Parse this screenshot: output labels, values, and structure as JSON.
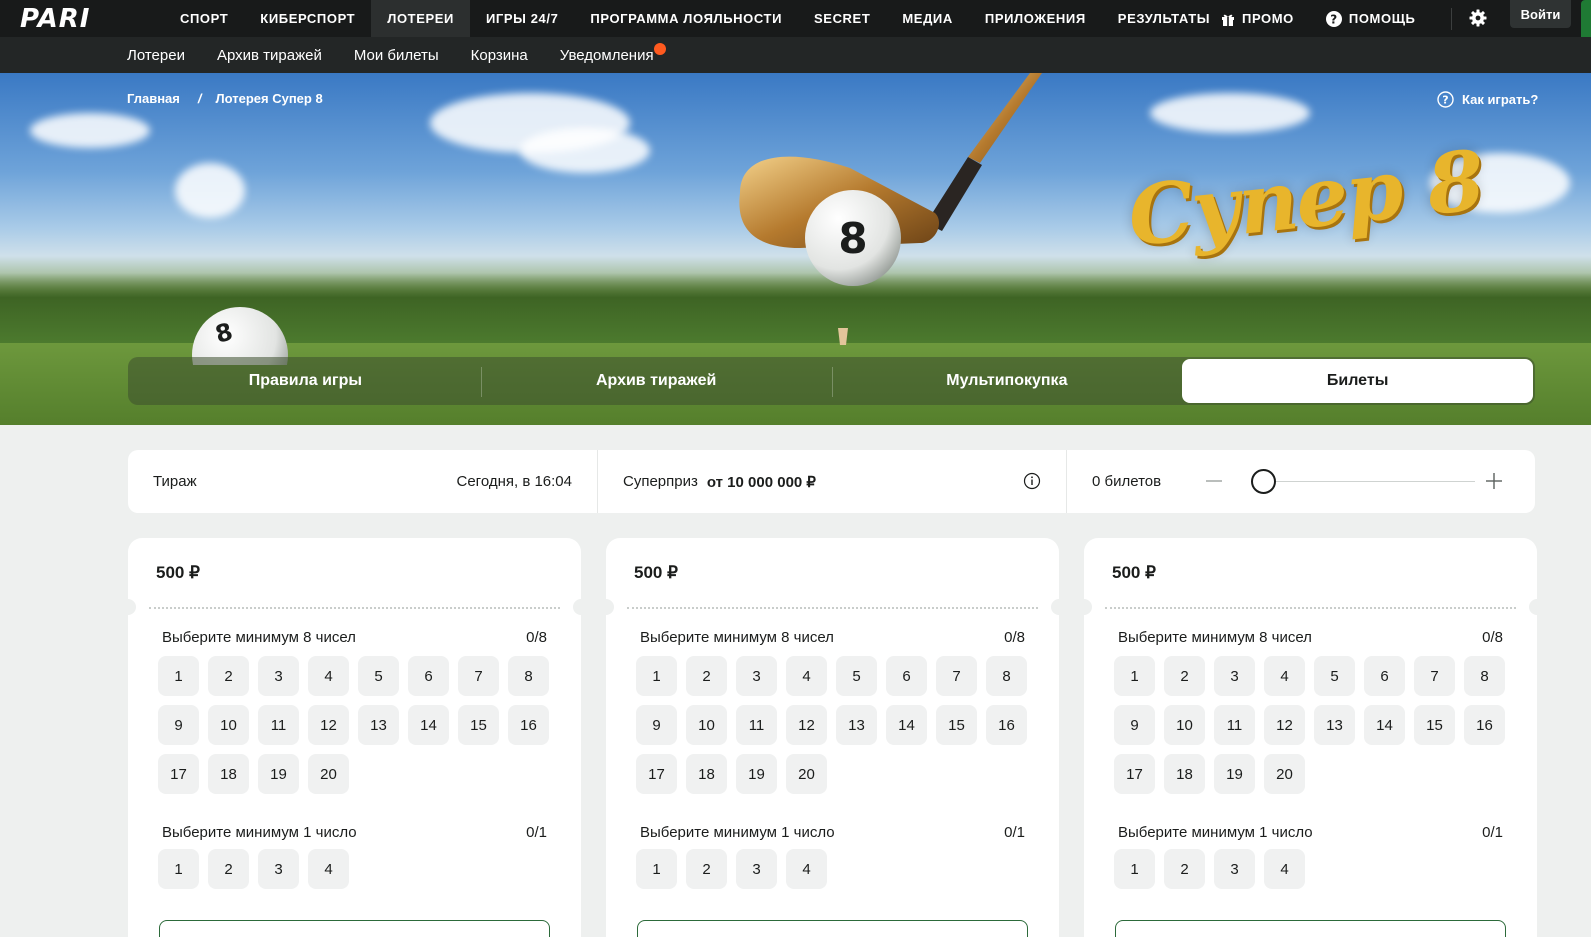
{
  "topnav": {
    "logo": "PARI",
    "items": [
      "СПОРТ",
      "КИБЕРСПОРТ",
      "ЛОТЕРЕИ",
      "ИГРЫ 24/7",
      "ПРОГРАММА ЛОЯЛЬНОСТИ",
      "SECRET",
      "МЕДИА",
      "ПРИЛОЖЕНИЯ",
      "РЕЗУЛЬТАТЫ"
    ],
    "active_item": "ЛОТЕРЕИ",
    "promo": "ПРОМО",
    "help": "ПОМОЩЬ",
    "login": "Войти"
  },
  "subnav": {
    "items": [
      "Лотереи",
      "Архив тиражей",
      "Мои билеты",
      "Корзина",
      "Уведомления"
    ]
  },
  "hero": {
    "breadcrumb": [
      "Главная",
      "Лотерея Супер 8"
    ],
    "how_to_play": "Как играть?",
    "brand_title": "Супер 8",
    "ball_number": "8",
    "tabs": [
      "Правила игры",
      "Архив тиражей",
      "Мультипокупка",
      "Билеты"
    ],
    "active_tab": "Билеты"
  },
  "infobar": {
    "draw_label": "Тираж",
    "draw_time": "Сегодня, в 16:04",
    "superprize_label": "Суперприз",
    "superprize_value": "от 10 000 000 ₽",
    "tickets_count": "0 билетов"
  },
  "tickets": [
    {
      "price": "500 ₽",
      "field1_label": "Выберите минимум 8 чисел",
      "field1_count": "0/8",
      "field1_numbers": [
        "1",
        "2",
        "3",
        "4",
        "5",
        "6",
        "7",
        "8",
        "9",
        "10",
        "11",
        "12",
        "13",
        "14",
        "15",
        "16",
        "17",
        "18",
        "19",
        "20"
      ],
      "field2_label": "Выберите минимум 1 число",
      "field2_count": "0/1",
      "field2_numbers": [
        "1",
        "2",
        "3",
        "4"
      ]
    },
    {
      "price": "500 ₽",
      "field1_label": "Выберите минимум 8 чисел",
      "field1_count": "0/8",
      "field1_numbers": [
        "1",
        "2",
        "3",
        "4",
        "5",
        "6",
        "7",
        "8",
        "9",
        "10",
        "11",
        "12",
        "13",
        "14",
        "15",
        "16",
        "17",
        "18",
        "19",
        "20"
      ],
      "field2_label": "Выберите минимум 1 число",
      "field2_count": "0/1",
      "field2_numbers": [
        "1",
        "2",
        "3",
        "4"
      ]
    },
    {
      "price": "500 ₽",
      "field1_label": "Выберите минимум 8 чисел",
      "field1_count": "0/8",
      "field1_numbers": [
        "1",
        "2",
        "3",
        "4",
        "5",
        "6",
        "7",
        "8",
        "9",
        "10",
        "11",
        "12",
        "13",
        "14",
        "15",
        "16",
        "17",
        "18",
        "19",
        "20"
      ],
      "field2_label": "Выберите минимум 1 число",
      "field2_count": "0/1",
      "field2_numbers": [
        "1",
        "2",
        "3",
        "4"
      ]
    }
  ],
  "colors": {
    "topnav_bg": "#181a1a",
    "subnav_bg": "#232626",
    "notification_dot": "#ff5a1f",
    "brand_gold": "#e8b52c",
    "button_border": "#2c6a3a"
  }
}
